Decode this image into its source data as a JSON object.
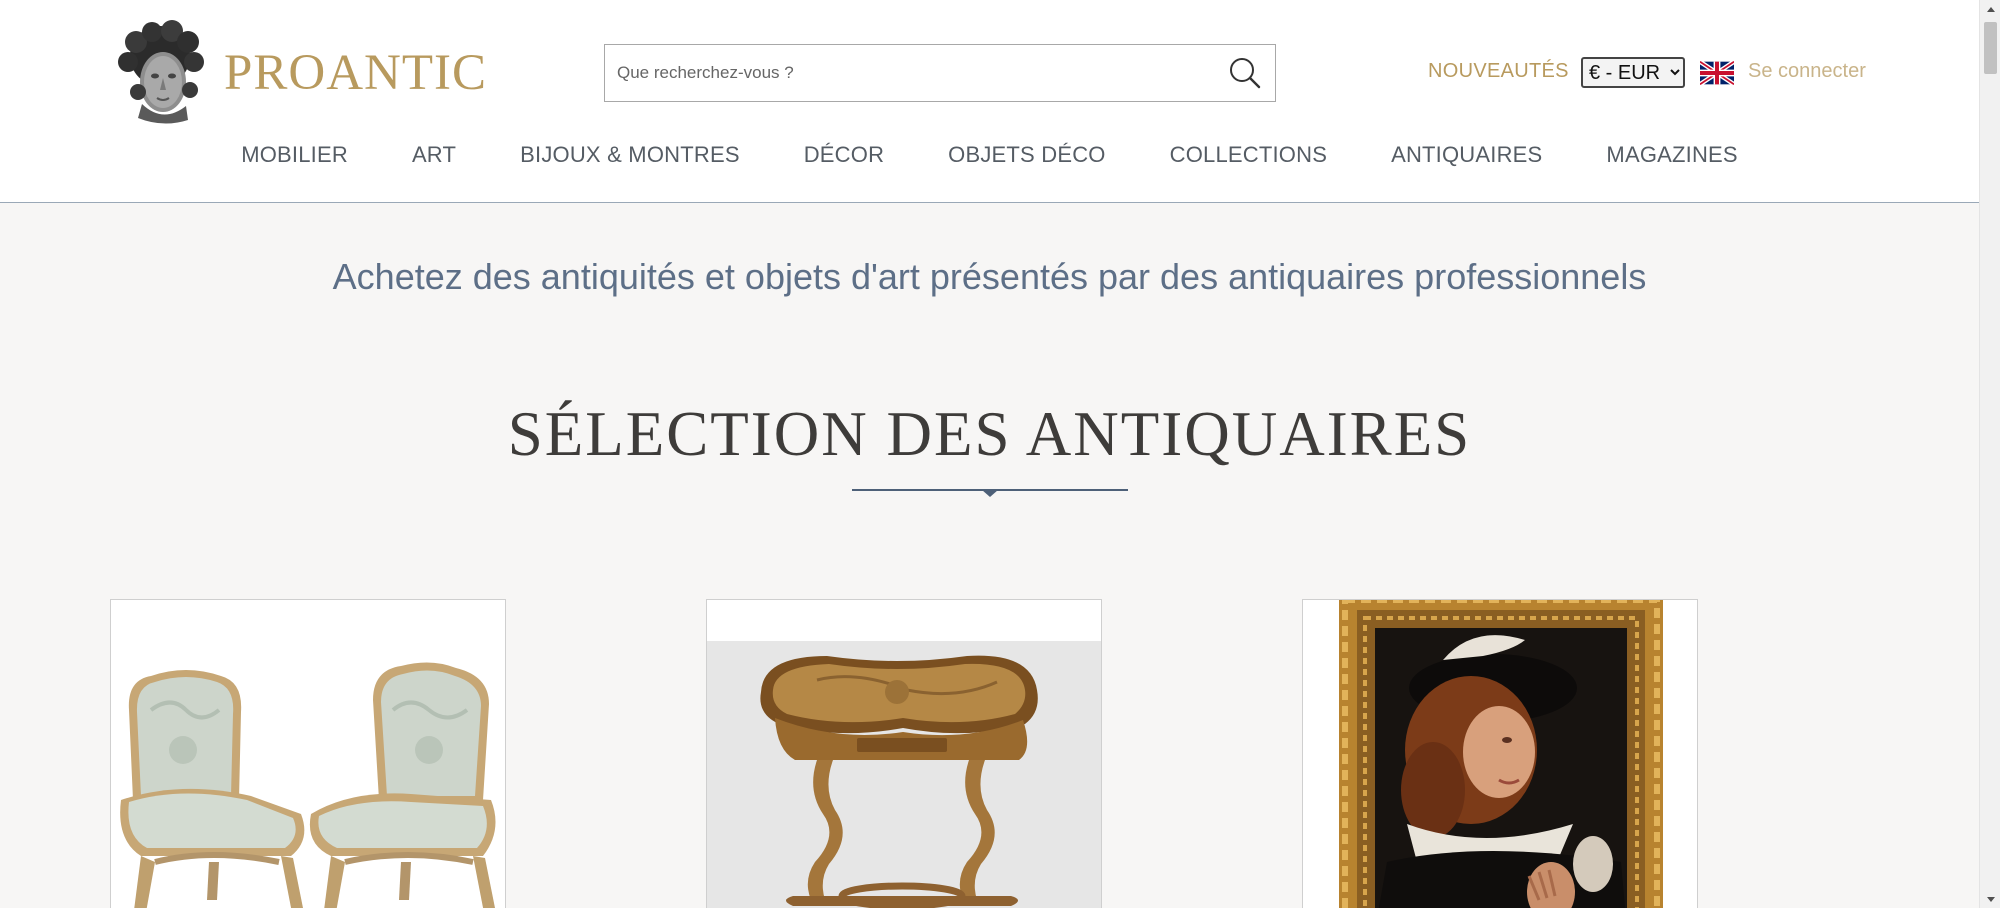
{
  "header": {
    "logo_text": "PROANTIC",
    "search": {
      "placeholder": "Que recherchez-vous ?"
    },
    "nouveautes": "NOUVEAUTÉS",
    "currency": {
      "selected": "€ - EUR"
    },
    "language_icon": "uk-flag-icon",
    "login": "Se connecter"
  },
  "nav": {
    "items": [
      {
        "label": "MOBILIER"
      },
      {
        "label": "ART"
      },
      {
        "label": "BIJOUX & MONTRES"
      },
      {
        "label": "DÉCOR"
      },
      {
        "label": "OBJETS DÉCO"
      },
      {
        "label": "COLLECTIONS"
      },
      {
        "label": "ANTIQUAIRES"
      },
      {
        "label": "MAGAZINES"
      }
    ]
  },
  "main": {
    "tagline": "Achetez des antiquités et objets d'art présentés par des antiquaires professionnels",
    "section_title": "SÉLECTION DES ANTIQUAIRES",
    "products": [
      {
        "image": "pair-of-louis-xv-chairs"
      },
      {
        "image": "marquetry-kidney-side-table"
      },
      {
        "image": "portrait-painting-in-gilt-frame"
      }
    ]
  },
  "colors": {
    "brand_gold": "#b89a5e",
    "login_gold": "#c9b48a",
    "tagline_blue": "#5d6f87",
    "nav_gray": "#555c64",
    "background": "#f7f6f5"
  }
}
